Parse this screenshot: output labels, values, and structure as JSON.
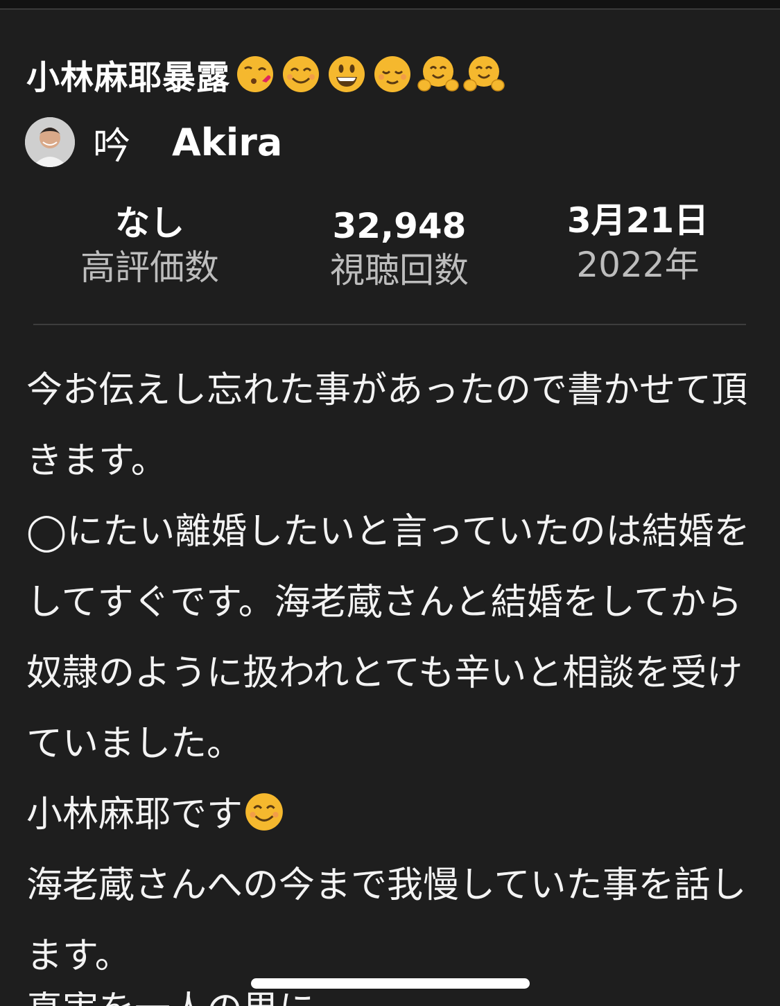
{
  "post": {
    "title": "小林麻耶暴露",
    "title_emojis": [
      "kissing-heart-emoji",
      "smiling-face-emoji",
      "grinning-face-emoji",
      "relieved-face-emoji",
      "hugging-face-emoji",
      "hugging-face-emoji"
    ]
  },
  "author": {
    "name_kanji": "吟",
    "name_latin": "Akira"
  },
  "stats": {
    "likes_value": "なし",
    "likes_label": "高評価数",
    "views_value": "32,948",
    "views_label": "視聴回数",
    "date_value": "3月21日",
    "date_year": "2022年"
  },
  "body": {
    "para1": "今お伝えし忘れた事があったので書かせて頂きます。",
    "para2": "◯にたい離婚したいと言っていたのは結婚をしてすぐです。海老蔵さんと結婚をしてから奴隷のように扱われとても辛いと相談を受けていました。",
    "para3": "小林麻耶です",
    "para4": "海老蔵さんへの今まで我慢していた事を話します。",
    "cut_line": "真実を一人の男に..."
  },
  "colors": {
    "background": "#1e1e1e",
    "text": "#f1f1f1",
    "secondary_text": "#bdbdbd",
    "divider": "#3d3d3d"
  }
}
